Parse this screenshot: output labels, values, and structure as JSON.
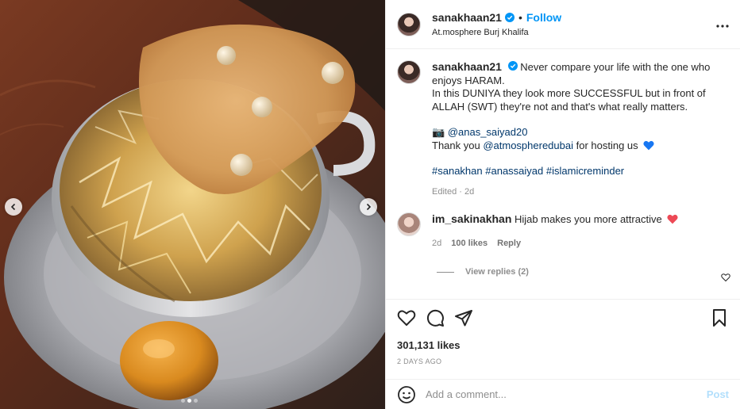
{
  "media": {
    "carousel_dots": [
      false,
      true,
      false
    ],
    "prev_icon": "chevron-left-icon",
    "next_icon": "chevron-right-icon"
  },
  "header": {
    "username": "sanakhaan21",
    "separator": "•",
    "follow_label": "Follow",
    "location": "At.mosphere Burj Khalifa",
    "more_icon": "more-horizontal-icon"
  },
  "caption": {
    "username": "sanakhaan21",
    "line1": "Never compare your life with the one who enjoys HARAM.",
    "line2": "In this DUNIYA they look more SUCCESSFUL but in front of ALLAH (SWT) they're not and that's what really matters.",
    "camera_emoji": "📷",
    "photo_credit": "@anas_saiyad20",
    "thanks_prefix": "Thank you",
    "thanks_mention": "@atmospheredubai",
    "thanks_suffix": "for hosting us",
    "hashtags": [
      "#sanakhan",
      "#anassaiyad",
      "#islamicreminder"
    ],
    "edited": "Edited",
    "edited_time": "2d"
  },
  "comment": {
    "username": "im_sakinakhan",
    "text": "Hijab makes you more attractive",
    "time": "2d",
    "likes": "100 likes",
    "reply_label": "Reply",
    "view_replies": "View replies (2)"
  },
  "actions": {
    "like_icon": "heart-icon",
    "comment_icon": "comment-icon",
    "share_icon": "share-icon",
    "save_icon": "bookmark-icon",
    "likes_count": "301,131 likes",
    "date": "2 DAYS AGO"
  },
  "add_comment": {
    "placeholder": "Add a comment...",
    "post_label": "Post"
  },
  "colors": {
    "link_blue": "#0095f6",
    "post_disabled": "#b2dffc",
    "verified_blue": "#0095f6",
    "heart_red": "#ed4956",
    "blue_heart": "#1877f2"
  }
}
